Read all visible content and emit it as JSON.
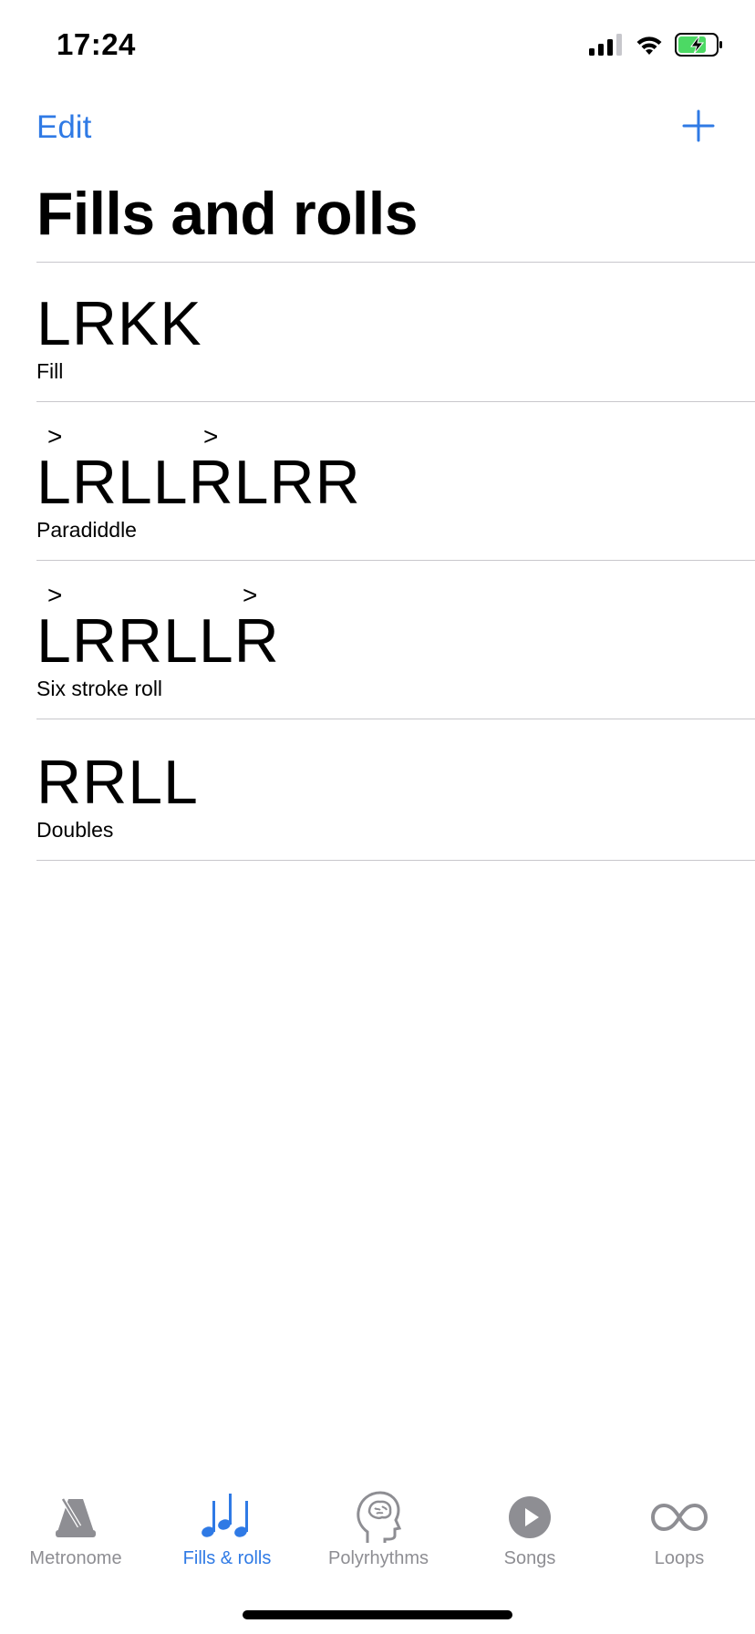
{
  "status_bar": {
    "time": "17:24"
  },
  "nav": {
    "edit_label": "Edit"
  },
  "title": "Fills and rolls",
  "items": [
    {
      "pattern": "LRKK",
      "name": "Fill"
    },
    {
      "pattern": "LRLLRLRR",
      "name": "Paradiddle",
      "accent_mark": ">"
    },
    {
      "pattern": "LRRLLR",
      "name": "Six stroke roll",
      "accent_mark": ">"
    },
    {
      "pattern": "RRLL",
      "name": "Doubles"
    }
  ],
  "tabs": [
    {
      "label": "Metronome",
      "icon": "metronome-icon"
    },
    {
      "label": "Fills & rolls",
      "icon": "music-notes-icon",
      "active": true
    },
    {
      "label": "Polyrhythms",
      "icon": "brain-head-icon"
    },
    {
      "label": "Songs",
      "icon": "play-circle-icon"
    },
    {
      "label": "Loops",
      "icon": "infinity-icon"
    }
  ],
  "colors": {
    "accent": "#2f7ae5",
    "inactive": "#8e8e93",
    "separator": "#c8c7cc",
    "battery_fill": "#4cd964"
  }
}
